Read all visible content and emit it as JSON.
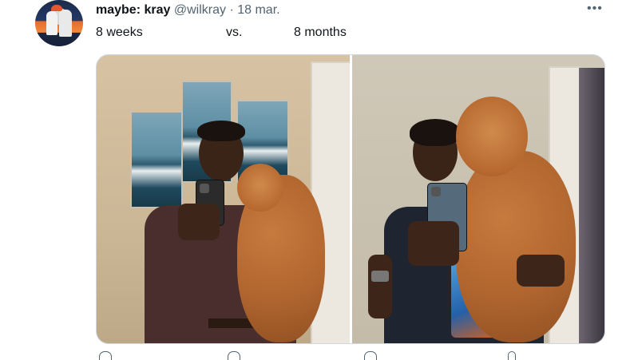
{
  "tweet": {
    "display_name": "maybe: kray",
    "handle": "@wilkray",
    "separator": "·",
    "date": "18 mar.",
    "more_label": "•••",
    "text_left": "8 weeks",
    "text_mid": "vs.",
    "text_right": "8 months"
  },
  "media": {
    "photos": [
      {
        "label": "photo-8-weeks"
      },
      {
        "label": "photo-8-months"
      }
    ]
  },
  "actions": [
    {
      "icon": "reply-icon"
    },
    {
      "icon": "retweet-icon"
    },
    {
      "icon": "like-icon"
    },
    {
      "icon": "share-icon"
    }
  ]
}
